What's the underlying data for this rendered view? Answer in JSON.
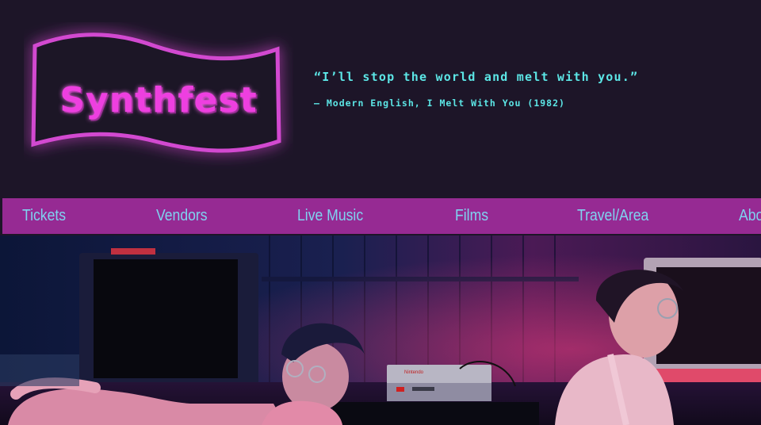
{
  "header": {
    "logo_text": "Synthfest",
    "quote": "“I’ll stop the world and melt with you.”",
    "quote_author": "— Modern English, I Melt With You (1982)"
  },
  "nav": {
    "items": [
      {
        "label": "Tickets"
      },
      {
        "label": "Vendors"
      },
      {
        "label": "Live Music"
      },
      {
        "label": "Films"
      },
      {
        "label": "Travel/Area"
      },
      {
        "label": "About"
      }
    ]
  },
  "colors": {
    "background": "#1d1528",
    "nav_bg": "#962a93",
    "nav_text": "#7fd3f0",
    "logo_pink": "#ee3fe0",
    "quote_cyan": "#5ce6e6"
  },
  "hero": {
    "console_label": "Nintendo"
  }
}
